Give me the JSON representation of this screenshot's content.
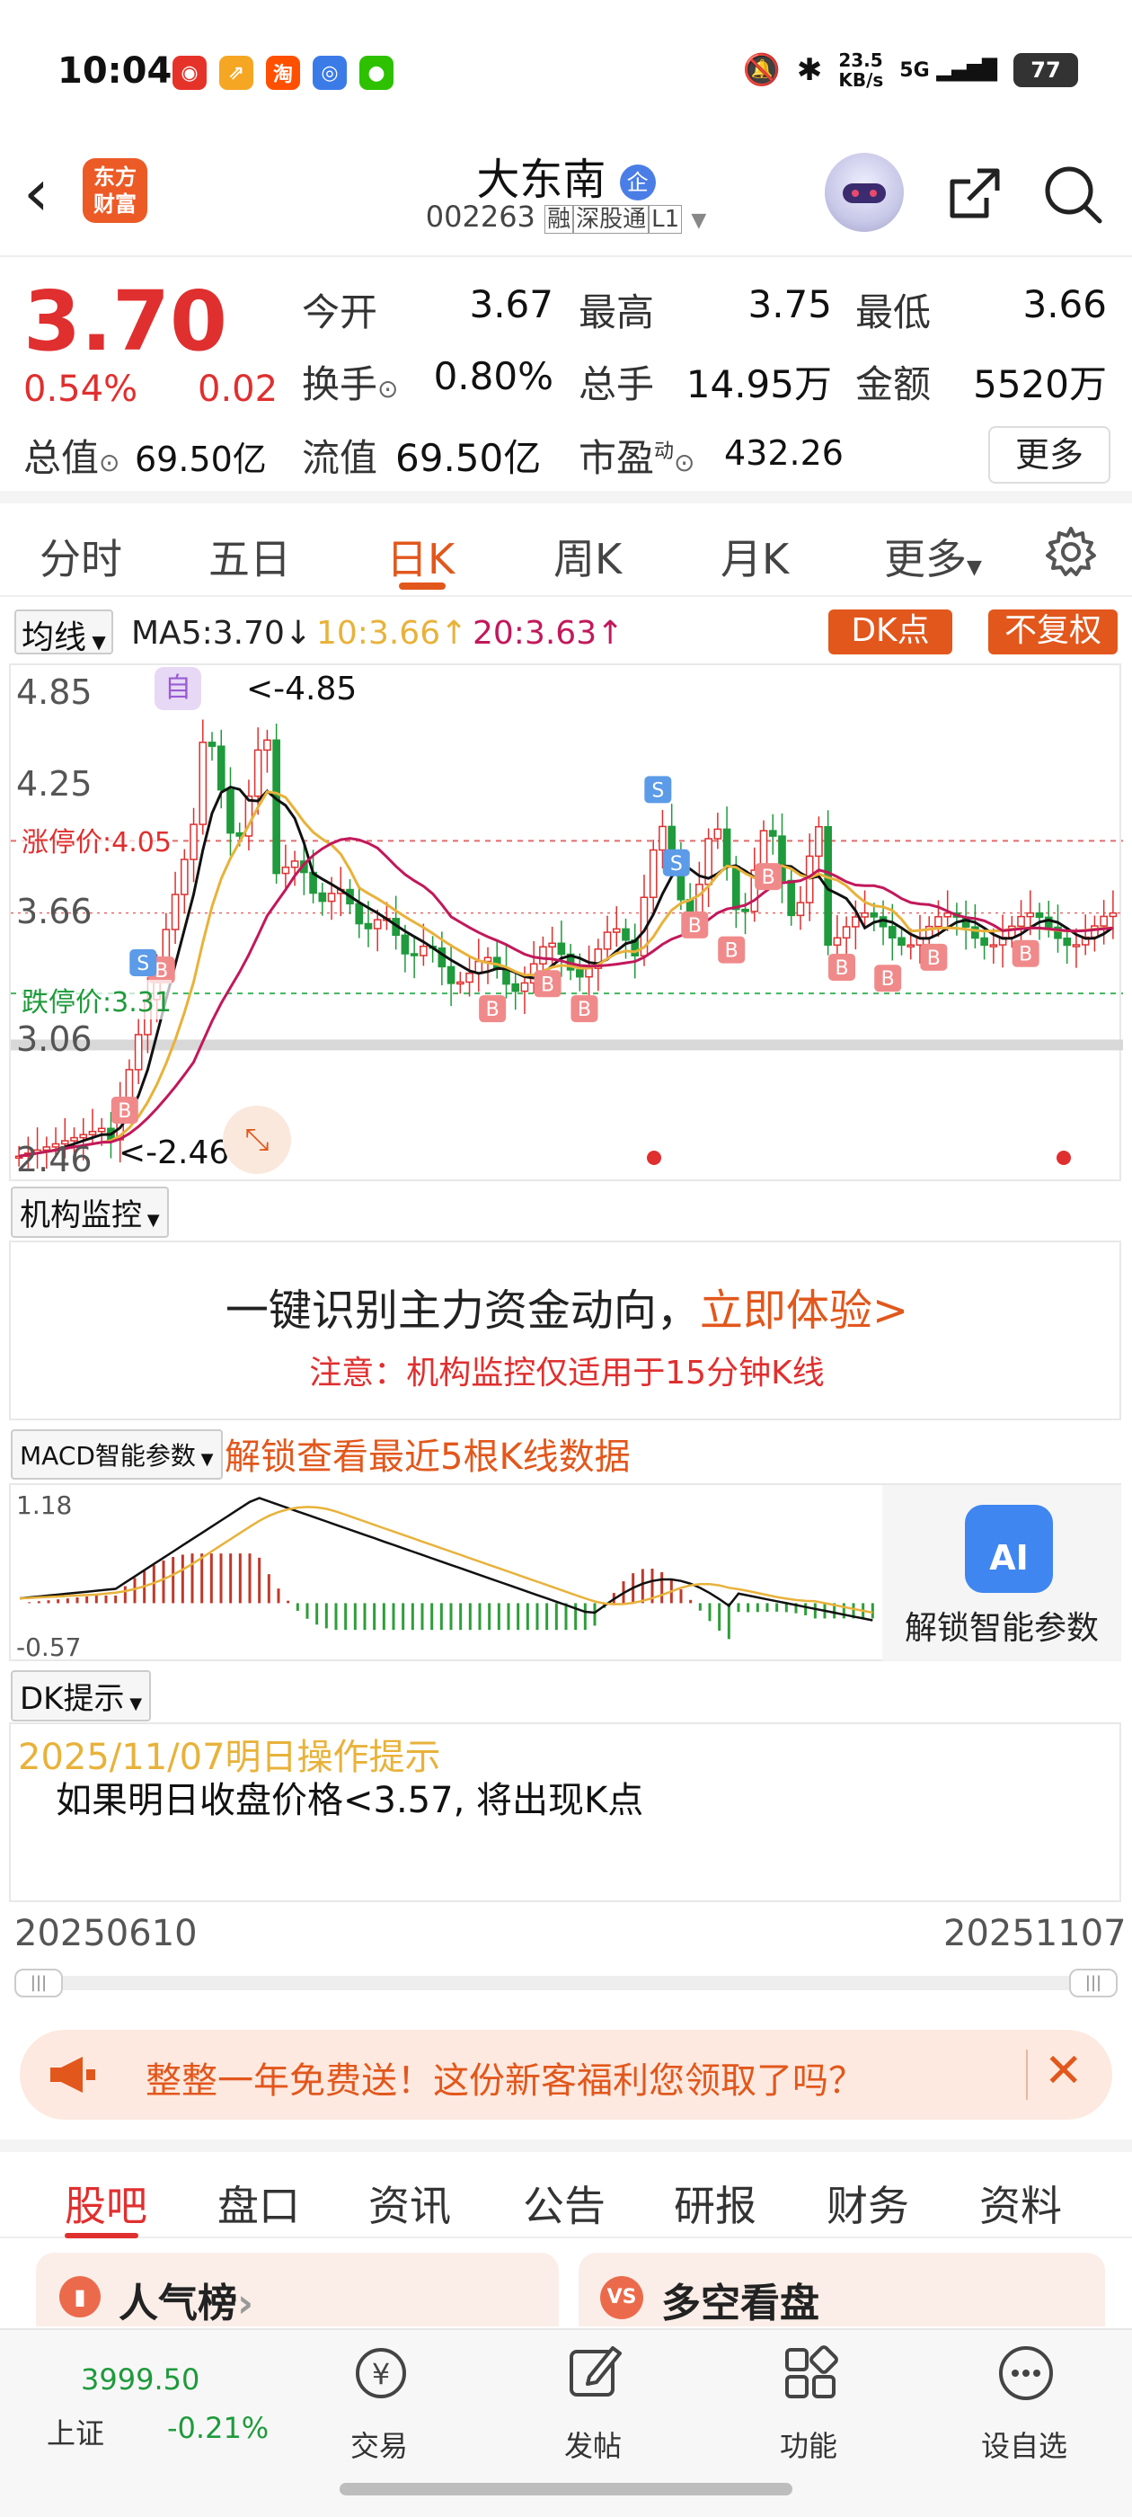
{
  "status": {
    "time": "10:04",
    "net_speed": "23.5",
    "net_unit": "KB/s",
    "network": "5G",
    "battery": "77",
    "apps": [
      {
        "name": "weibo-icon",
        "color": "#e6332a",
        "glyph": "◉"
      },
      {
        "name": "app-orange-icon",
        "color": "#f5a623",
        "glyph": "⇗"
      },
      {
        "name": "taobao-icon",
        "color": "#ff5000",
        "glyph": "淘"
      },
      {
        "name": "app-blue-icon",
        "color": "#3b7be8",
        "glyph": "◎"
      },
      {
        "name": "wechat-icon",
        "color": "#2dc100",
        "glyph": "●"
      }
    ]
  },
  "header": {
    "logo_line1": "东方",
    "logo_line2": "财富",
    "name": "大东南",
    "name_badge": "企",
    "code": "002263",
    "tags": [
      "融",
      "深股通",
      "L1"
    ]
  },
  "quote": {
    "price": "3.70",
    "pct": "0.54%",
    "change": "0.02",
    "open_label": "今开",
    "open": "3.67",
    "high_label": "最高",
    "high": "3.75",
    "low_label": "最低",
    "low": "3.66",
    "turnover_label": "换手",
    "turnover": "0.80%",
    "volume_label": "总手",
    "volume": "14.95万",
    "amount_label": "金额",
    "amount": "5520万",
    "mcap_label": "总值",
    "mcap": "69.50亿",
    "float_label": "流值",
    "float": "69.50亿",
    "pe_label": "市盈",
    "pe_sup": "动",
    "pe": "432.26",
    "more": "更多"
  },
  "period_tabs": [
    "分时",
    "五日",
    "日K",
    "周K",
    "月K",
    "更多"
  ],
  "period_active": 2,
  "ma": {
    "select": "均线",
    "ma5": "MA5:3.70",
    "ma5_arrow": "↓",
    "ma10": "10:3.66",
    "ma10_arrow": "↑",
    "ma20": "20:3.63",
    "ma20_arrow": "↑",
    "dk_btn": "DK点",
    "adjust_btn": "不复权"
  },
  "chart": {
    "y_labels": [
      "4.85",
      "4.25",
      "3.66",
      "3.06",
      "2.46"
    ],
    "limit_up": "涨停价:4.05",
    "limit_down": "跌停价:3.31",
    "max_note": "<-4.85",
    "min_note": "<-2.46",
    "auto_tag": "自"
  },
  "chart_data": {
    "type": "candlestick",
    "ylim": [
      2.46,
      4.85
    ],
    "y_ticks": [
      4.85,
      4.25,
      3.66,
      3.06,
      2.46
    ],
    "x_start": "20250610",
    "x_end": "20251107",
    "max": 4.85,
    "min": 2.46,
    "limit_up": 4.05,
    "limit_down": 3.31,
    "ma5": 3.7,
    "ma10": 3.66,
    "ma20": 3.63,
    "macd_range": [
      -0.57,
      1.18
    ]
  },
  "inst_panel": {
    "select": "机构监控",
    "headline": "一键识别主力资金动向，",
    "cta": "立即体验>",
    "note": "注意：机构监控仅适用于15分钟K线"
  },
  "macd": {
    "select": "MACD智能参数",
    "unlock_text": "解锁查看最近5根K线数据",
    "top": "1.18",
    "bottom": "-0.57",
    "ai_label": "AI",
    "ai_unlock": "解锁智能参数"
  },
  "dk": {
    "select": "DK提示",
    "title": "2025/11/07明日操作提示",
    "body": "如果明日收盘价格<3.57, 将出现K点"
  },
  "range": {
    "start": "20250610",
    "end": "20251107"
  },
  "banner": {
    "text": "整整一年免费送！这份新客福利您领取了吗？"
  },
  "bottom_tabs": [
    "股吧",
    "盘口",
    "资讯",
    "公告",
    "研报",
    "财务",
    "资料"
  ],
  "cards": [
    {
      "label": "人气榜",
      "badge": "",
      "arrow": "›"
    },
    {
      "label": "多空看盘",
      "badge": "VS"
    }
  ],
  "nav": {
    "index_value": "3999.50",
    "index_name": "上证",
    "index_change": "-0.21%",
    "items": [
      "交易",
      "发帖",
      "功能",
      "设自选"
    ]
  }
}
